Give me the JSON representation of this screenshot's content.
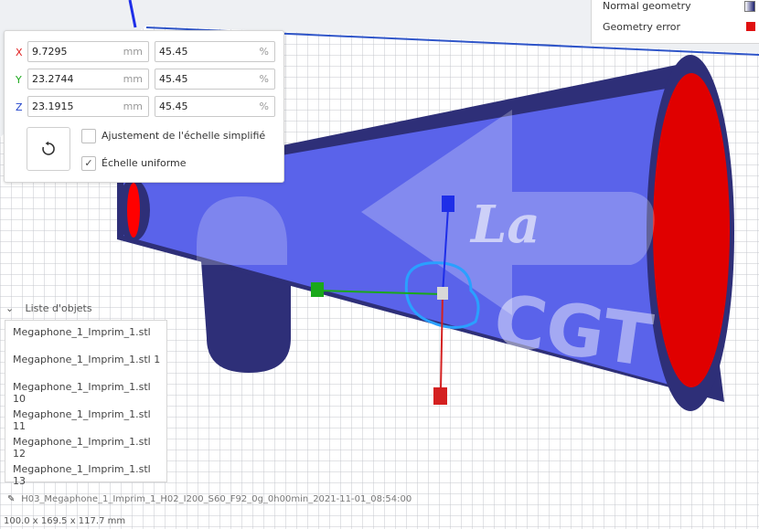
{
  "scale_panel": {
    "rows": [
      {
        "axis": "X",
        "axis_color": "#e02020",
        "size": "9.7295",
        "size_unit": "mm",
        "percent": "45.45",
        "percent_unit": "%"
      },
      {
        "axis": "Y",
        "axis_color": "#1aa81a",
        "size": "23.2744",
        "size_unit": "mm",
        "percent": "45.45",
        "percent_unit": "%"
      },
      {
        "axis": "Z",
        "axis_color": "#2244cc",
        "size": "23.1915",
        "size_unit": "mm",
        "percent": "45.45",
        "percent_unit": "%"
      }
    ],
    "reset_icon": "reset-rotate-icon",
    "simplified_label": "Ajustement de l'échelle simplifié",
    "simplified_checked": false,
    "uniform_label": "Échelle uniforme",
    "uniform_checked": true,
    "check_mark": "✓"
  },
  "legend": {
    "items": [
      {
        "label": "Normal geometry",
        "color": "#1b1e6e"
      },
      {
        "label": "Geometry error",
        "color": "#e01010"
      }
    ]
  },
  "object_list": {
    "title": "Liste d'objets",
    "items": [
      "Megaphone_1_Imprim_1.stl",
      "Megaphone_1_Imprim_1.stl 1",
      "Megaphone_1_Imprim_1.stl 10",
      "Megaphone_1_Imprim_1.stl 11",
      "Megaphone_1_Imprim_1.stl 12",
      "Megaphone_1_Imprim_1.stl 13"
    ]
  },
  "status": {
    "job_name": "H03_Megaphone_1_Imprim_1_H02_I200_S60_F92_0g_0h00min_2021-11-01_08:54:00",
    "dimensions": "100.0 x 169.5 x 117.7 mm"
  },
  "model": {
    "text_la": "La",
    "text_cgt": "CGT"
  }
}
